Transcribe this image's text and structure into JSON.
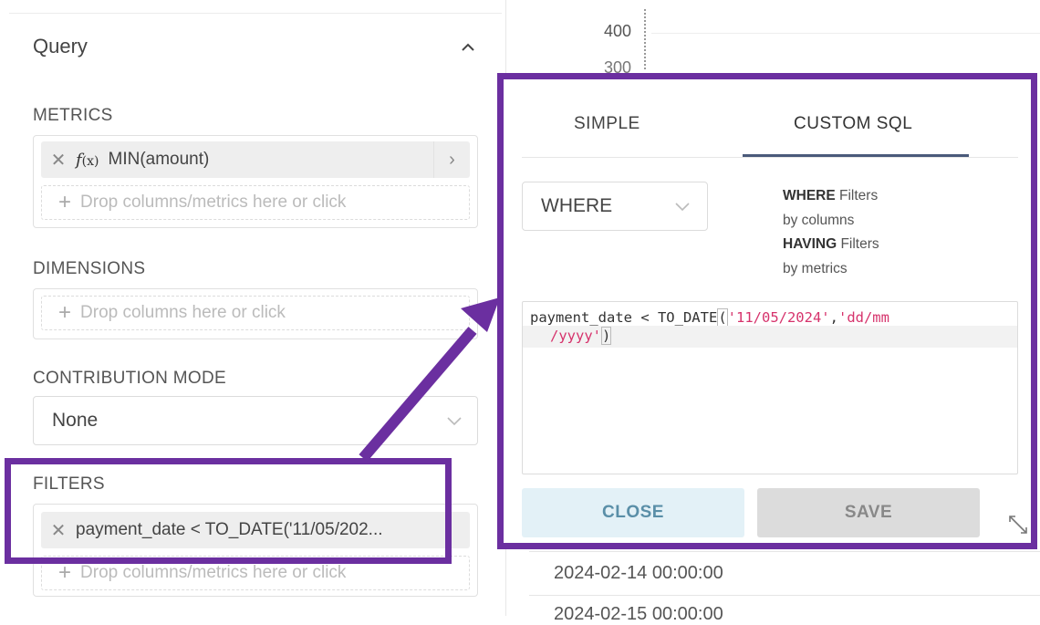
{
  "query_panel": {
    "title": "Query",
    "metrics": {
      "label": "METRICS",
      "item_text": "MIN(amount)",
      "fx_label": "f",
      "fx_sub": "(x)",
      "drop_hint": "Drop columns/metrics here or click"
    },
    "dimensions": {
      "label": "DIMENSIONS",
      "drop_hint": "Drop columns here or click"
    },
    "contribution_mode": {
      "label": "CONTRIBUTION MODE",
      "value": "None"
    },
    "filters": {
      "label": "FILTERS",
      "item_text": "payment_date < TO_DATE('11/05/202...",
      "drop_hint": "Drop columns/metrics here or click"
    }
  },
  "background_chart": {
    "axis_tick_400": "400",
    "axis_tick_partial": "300",
    "rows": [
      "2024-02-14 00:00:00",
      "2024-02-15 00:00:00"
    ]
  },
  "popover": {
    "tabs": [
      "SIMPLE",
      "CUSTOM SQL"
    ],
    "active_tab": "CUSTOM SQL",
    "clause_select": "WHERE",
    "help": {
      "where_bold": "WHERE",
      "where_text1": " Filters",
      "where_text2": "by columns",
      "having_bold": "HAVING",
      "having_text1": " Filters",
      "having_text2": "by metrics"
    },
    "sql": {
      "prefix": "payment_date < TO_DATE",
      "open_paren": "(",
      "str1": "'11/05/2024'",
      "comma": ",",
      "str2a": "'dd/mm",
      "str2b": "/yyyy'",
      "close_paren": ")"
    },
    "close_label": "CLOSE",
    "save_label": "SAVE"
  },
  "colors": {
    "annotation": "#6b2fa0",
    "sql_string": "#d6336c",
    "close_bg": "#e3f1f7",
    "save_bg": "#dcdcdc"
  }
}
